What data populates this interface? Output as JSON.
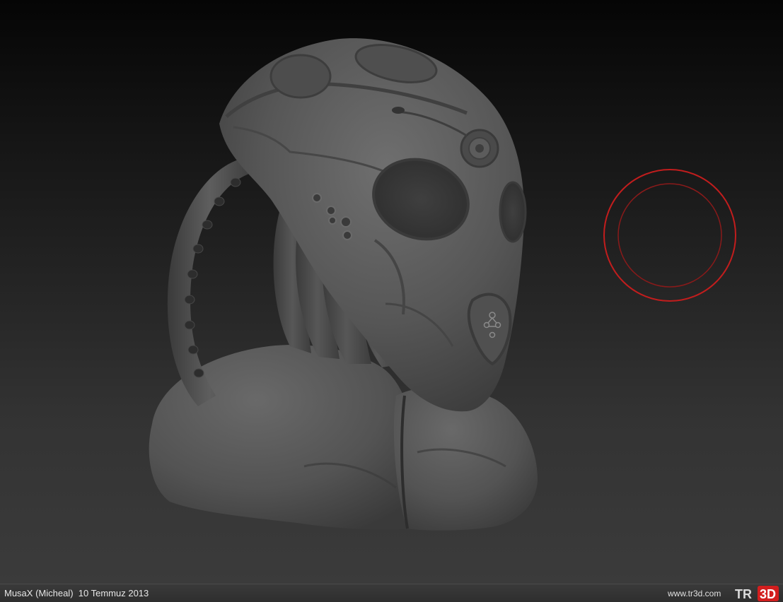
{
  "footer": {
    "author": "MusaX (Micheal)",
    "date": "10 Temmuz 2013",
    "site_url": "www.tr3d.com",
    "logo_text_tr": "TR",
    "logo_text_3d": "3D"
  },
  "colors": {
    "brush_ring": "#c21d1d",
    "brush_ring_inner": "#8a1a1a",
    "logo_red": "#d21e1e",
    "model_base": "#585858"
  },
  "viewport": {
    "model": "sculpted alien helmet bust",
    "cursor": "brush-cursor-circle"
  }
}
